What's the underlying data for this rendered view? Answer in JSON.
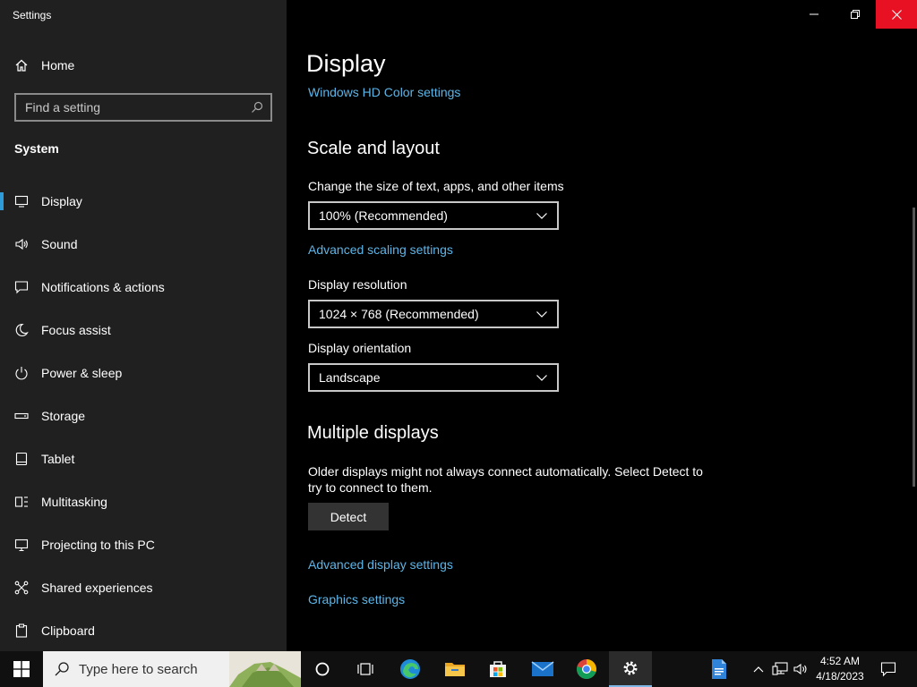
{
  "window": {
    "title": "Settings"
  },
  "sidebar": {
    "home_label": "Home",
    "search_placeholder": "Find a setting",
    "section": "System",
    "items": [
      {
        "label": "Display",
        "icon": "monitor-icon",
        "selected": true
      },
      {
        "label": "Sound",
        "icon": "speaker-icon"
      },
      {
        "label": "Notifications & actions",
        "icon": "notification-icon"
      },
      {
        "label": "Focus assist",
        "icon": "moon-icon"
      },
      {
        "label": "Power & sleep",
        "icon": "power-icon"
      },
      {
        "label": "Storage",
        "icon": "storage-icon"
      },
      {
        "label": "Tablet",
        "icon": "tablet-icon"
      },
      {
        "label": "Multitasking",
        "icon": "multitasking-icon"
      },
      {
        "label": "Projecting to this PC",
        "icon": "projecting-icon"
      },
      {
        "label": "Shared experiences",
        "icon": "shared-icon"
      },
      {
        "label": "Clipboard",
        "icon": "clipboard-icon"
      }
    ]
  },
  "main": {
    "title": "Display",
    "hd_color_link": "Windows HD Color settings",
    "scale_heading": "Scale and layout",
    "scale_label": "Change the size of text, apps, and other items",
    "scale_value": "100% (Recommended)",
    "advanced_scaling_link": "Advanced scaling settings",
    "resolution_label": "Display resolution",
    "resolution_value": "1024 × 768 (Recommended)",
    "orientation_label": "Display orientation",
    "orientation_value": "Landscape",
    "multiple_heading": "Multiple displays",
    "multiple_desc": "Older displays might not always connect automatically. Select Detect to try to connect to them.",
    "detect_button": "Detect",
    "advanced_display_link": "Advanced display settings",
    "graphics_link": "Graphics settings"
  },
  "taskbar": {
    "search_placeholder": "Type here to search",
    "time": "4:52 AM",
    "date": "4/18/2023",
    "apps": [
      "cortana-icon",
      "task-view-icon",
      "edge-icon",
      "file-explorer-icon",
      "store-icon",
      "mail-icon",
      "chrome-icon",
      "settings-icon",
      "document-icon"
    ]
  },
  "colors": {
    "accent": "#2d9cd8",
    "link": "#5db5e8",
    "close": "#e81123",
    "sidebar_bg": "#202020"
  }
}
